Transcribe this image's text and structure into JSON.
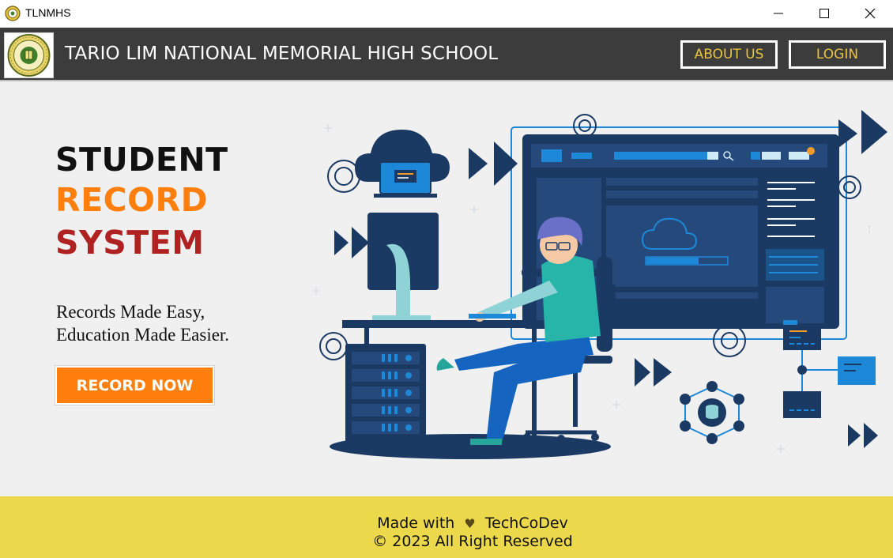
{
  "window": {
    "title": "TLNMHS",
    "controls": [
      "minimize-icon",
      "maximize-icon",
      "close-icon"
    ]
  },
  "header": {
    "school_name": "TARIO LIM NATIONAL MEMORIAL HIGH SCHOOL",
    "about_label": "ABOUT US",
    "login_label": "LOGIN"
  },
  "hero": {
    "title_line1": "STUDENT",
    "title_line2": "RECORD",
    "title_line3": "SYSTEM",
    "tagline_line1": "Records Made Easy,",
    "tagline_line2": "Education Made Easier.",
    "cta_label": "RECORD NOW"
  },
  "footer": {
    "made_with": "Made with",
    "heart": "♥",
    "brand": "TechCoDev",
    "copyright": "© 2023 All Right Reserved"
  },
  "colors": {
    "header_bg": "#3c3c3c",
    "header_button_text": "#e9c53e",
    "accent_orange": "#ff7f0e",
    "accent_red": "#b02222",
    "footer_bg": "#ecd94b",
    "illustration_navy": "#1b3a63",
    "illustration_blue": "#1e88d8"
  }
}
